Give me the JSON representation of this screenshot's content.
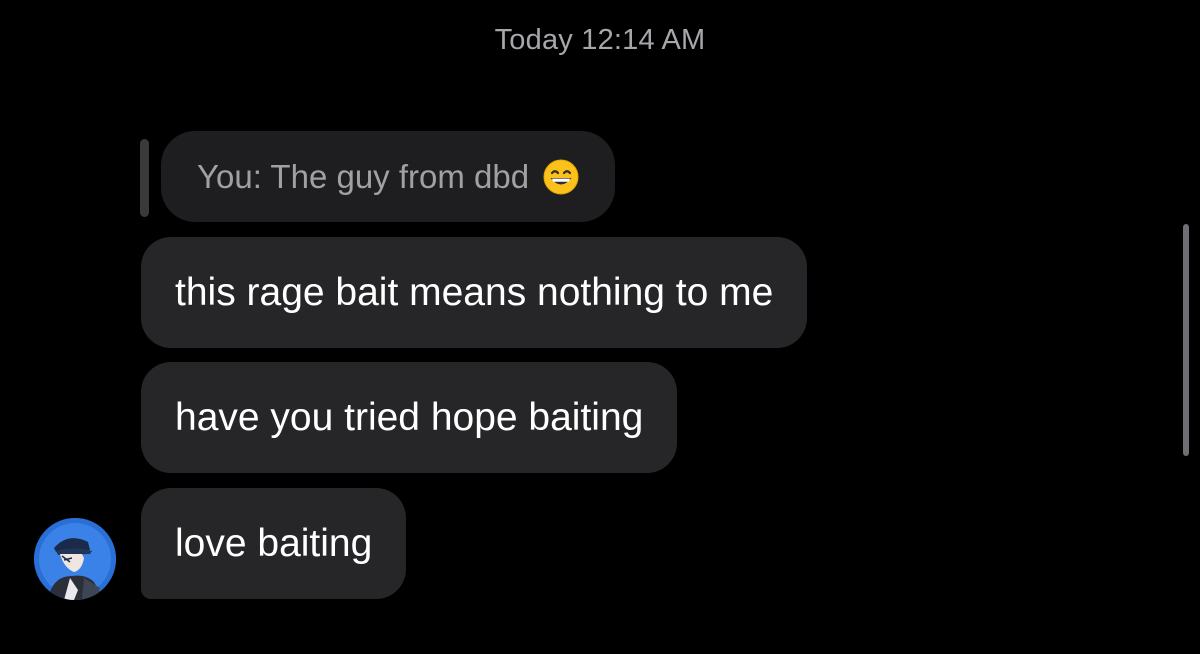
{
  "conversation": {
    "timestamp": "Today 12:14 AM",
    "reply_preview": {
      "text": "You: The guy from dbd",
      "emoji": "grinning-face-with-smiling-eyes"
    },
    "messages": [
      {
        "text": "this rage bait means nothing to me"
      },
      {
        "text": "have you tried hope baiting"
      },
      {
        "text": "love baiting"
      }
    ]
  },
  "colors": {
    "background": "#000000",
    "bubble": "#262628",
    "reply_bubble": "#1e1e20",
    "timestamp_text": "#a7a7ab",
    "avatar_bg": "#2a6fd6"
  }
}
